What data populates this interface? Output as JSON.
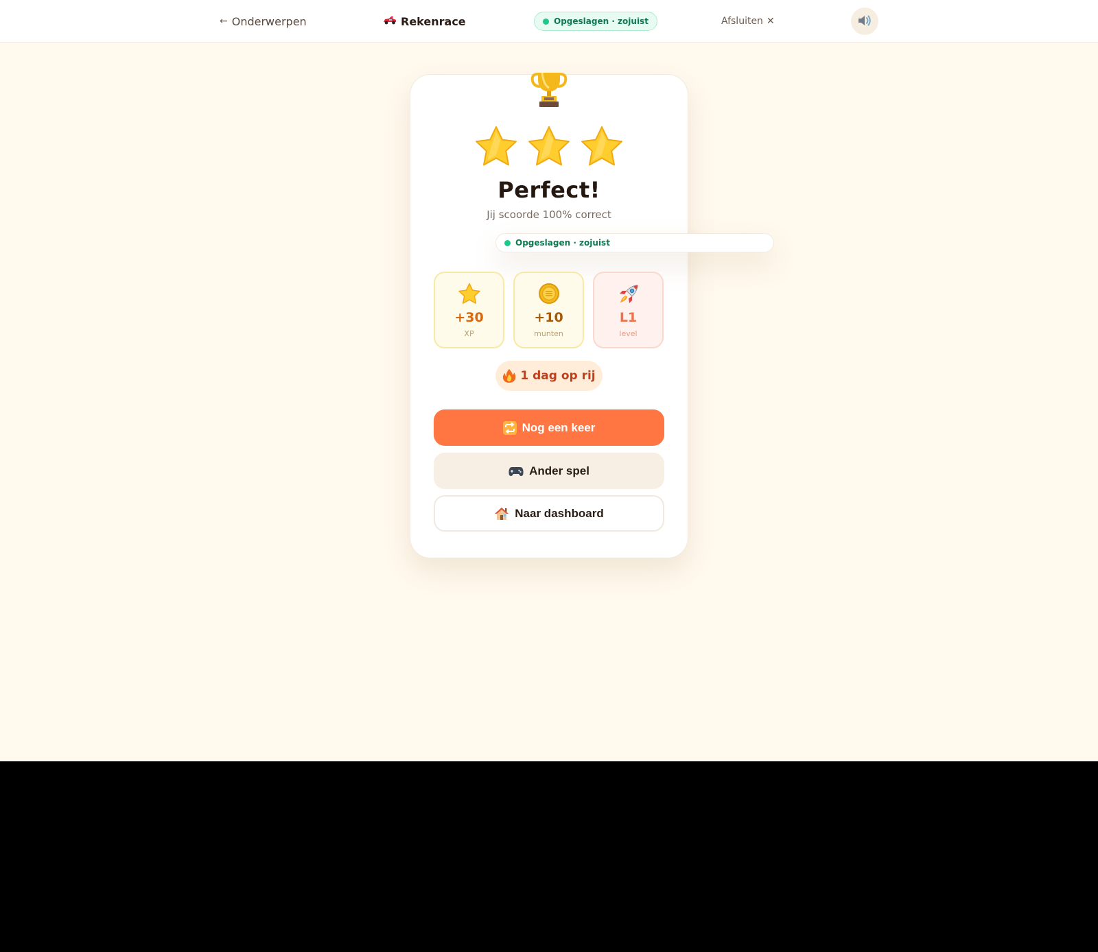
{
  "topbar": {
    "back_label": "Onderwerpen",
    "game_title": "Rekenrace",
    "save_status": "Opgeslagen · zojuist",
    "close_label": "Afsluiten"
  },
  "result": {
    "stars_earned": 3,
    "stars_total": 3,
    "title": "Perfect!",
    "subtitle": "Jij scoorde 100% correct",
    "save_status": "Opgeslagen · zojuist"
  },
  "rewards": [
    {
      "value": "+30",
      "label": "XP",
      "icon": "star-icon"
    },
    {
      "value": "+10",
      "label": "munten",
      "icon": "coin-icon"
    },
    {
      "value": "L1",
      "label": "level",
      "icon": "rocket-icon"
    }
  ],
  "streak": {
    "text": "1 dag op rij",
    "icon": "fire-icon"
  },
  "buttons": {
    "again": "Nog een keer",
    "other_game": "Ander spel",
    "dashboard": "Naar dashboard"
  },
  "colors": {
    "accent": "#ff7643",
    "background": "#fff9ee",
    "success": "#1cc98a",
    "streak_text": "#c1401b"
  }
}
